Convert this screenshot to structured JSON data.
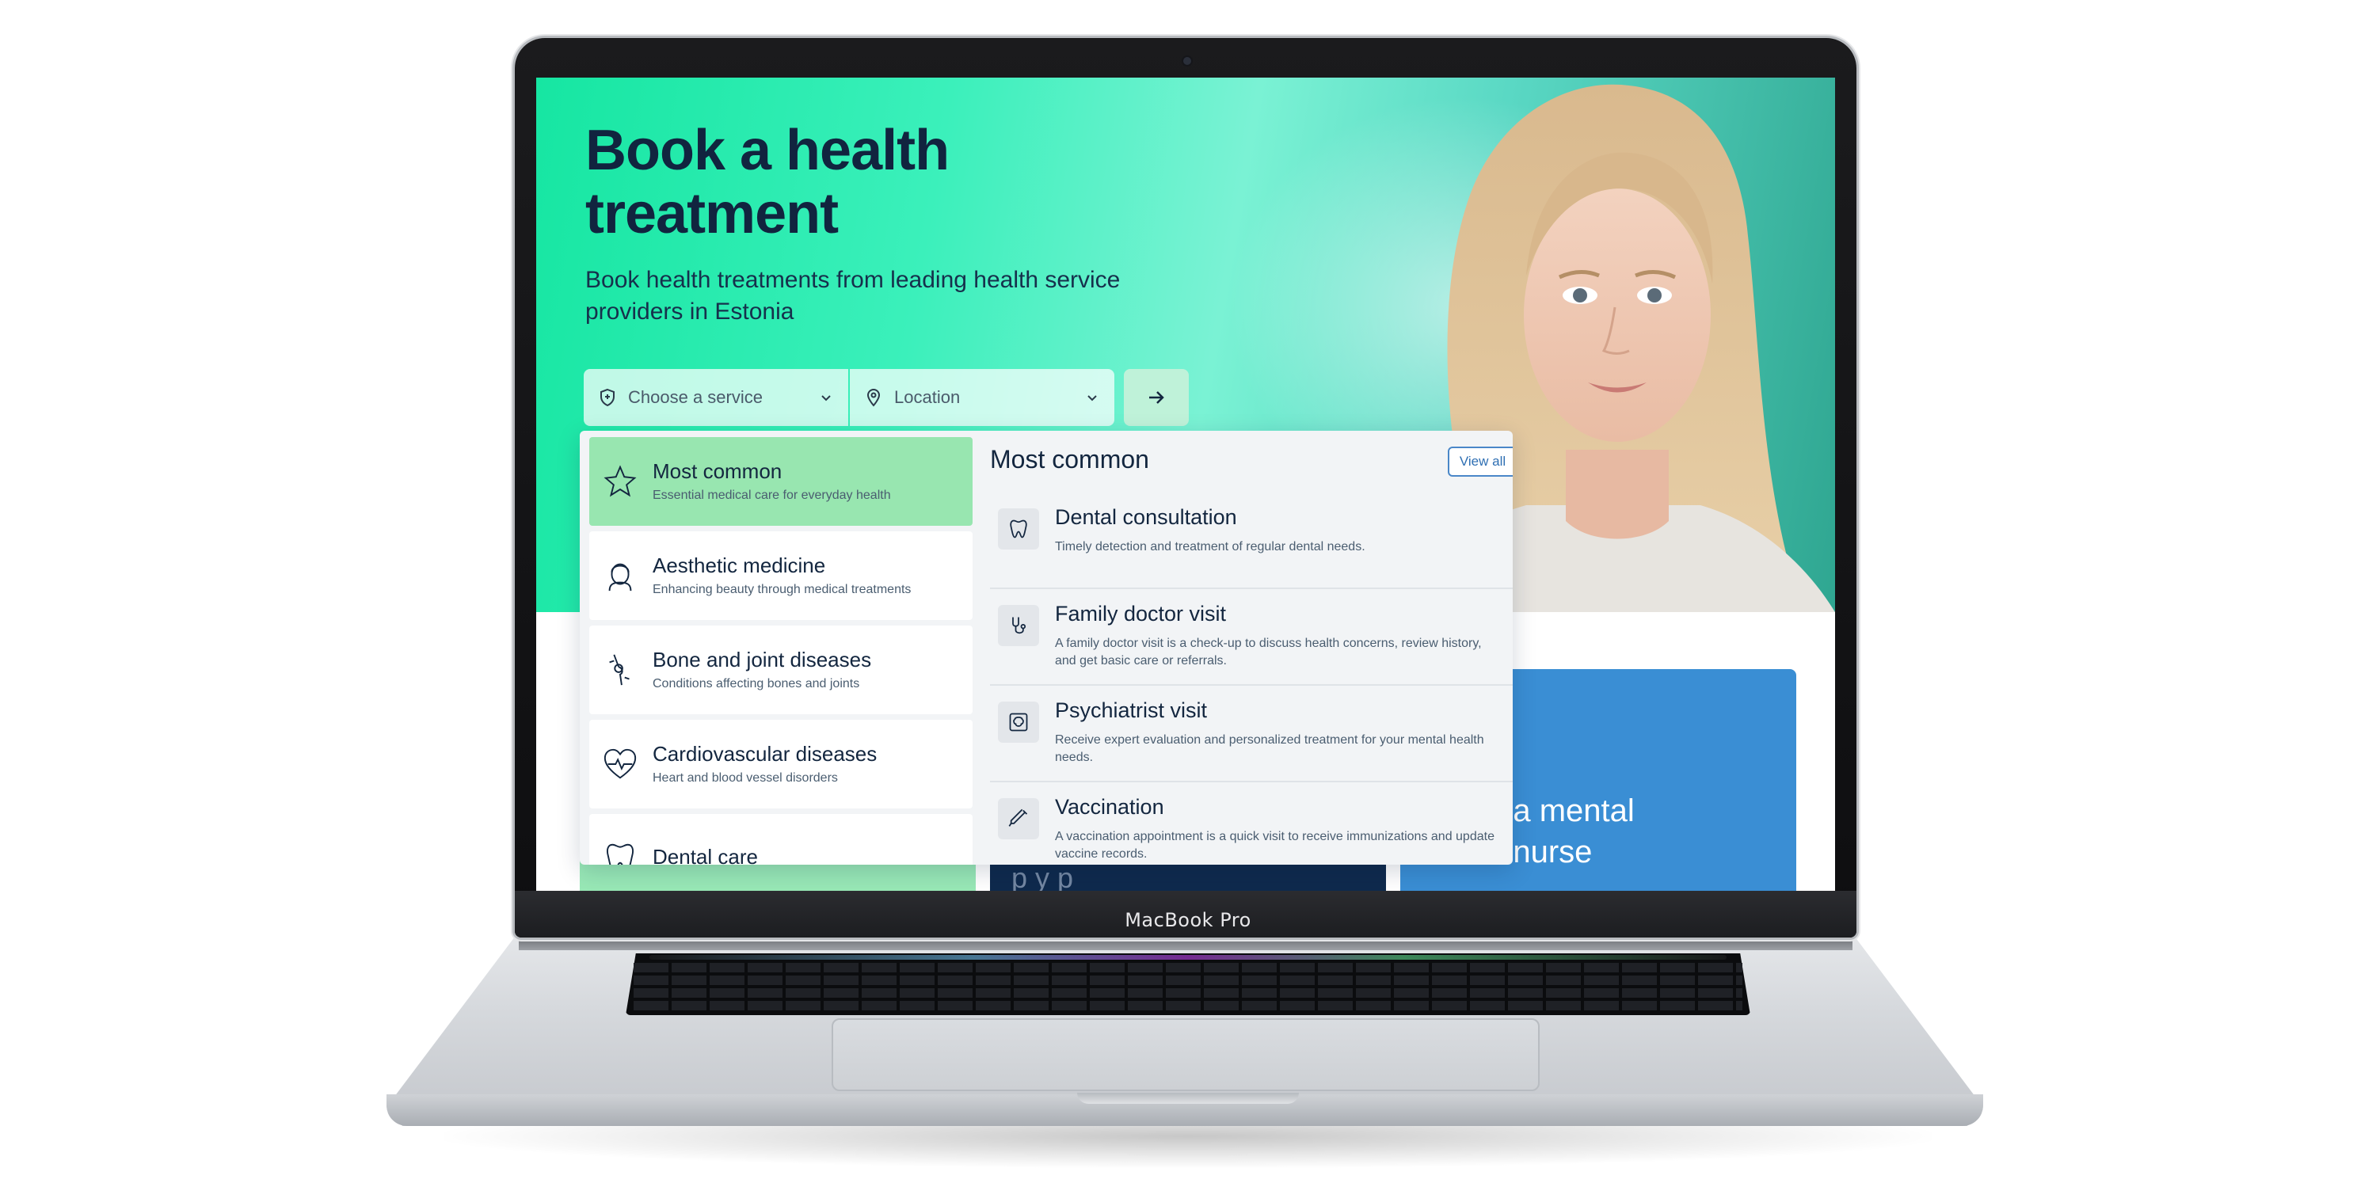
{
  "device": {
    "label": "MacBook Pro"
  },
  "hero": {
    "title": "Book a health treatment",
    "subtitle": "Book health treatments from leading health service providers in Estonia"
  },
  "search": {
    "service_placeholder": "Choose a service",
    "location_placeholder": "Location"
  },
  "dropdown": {
    "categories": [
      {
        "title": "Most common",
        "description": "Essential medical care for everyday health",
        "icon": "star-icon",
        "active": true
      },
      {
        "title": "Aesthetic medicine",
        "description": "Enhancing beauty through medical treatments",
        "icon": "face-icon"
      },
      {
        "title": "Bone and joint diseases",
        "description": "Conditions affecting bones and joints",
        "icon": "joint-icon"
      },
      {
        "title": "Cardiovascular diseases",
        "description": "Heart and blood vessel disorders",
        "icon": "heart-pulse-icon"
      },
      {
        "title": "Dental care",
        "description": "",
        "icon": "tooth-icon"
      }
    ],
    "services_heading": "Most common",
    "view_all": "View all",
    "services": [
      {
        "title": "Dental consultation",
        "description": "Timely detection and treatment of regular dental needs.",
        "icon": "tooth-icon"
      },
      {
        "title": "Family doctor visit",
        "description": "A family doctor visit is a check-up to discuss health concerns, review history, and get basic care or referrals.",
        "icon": "stethoscope-icon"
      },
      {
        "title": "Psychiatrist visit",
        "description": "Receive expert evaluation and personalized treatment for your mental health needs.",
        "icon": "brain-icon"
      },
      {
        "title": "Vaccination",
        "description": "A vaccination appointment is a quick visit to receive immunizations and update vaccine records.",
        "icon": "syringe-icon"
      }
    ]
  },
  "cards": {
    "blue_text_line1": "o a mental",
    "blue_text_line2": "h nurse",
    "navy_text": "p   y         p"
  },
  "colors": {
    "hero_green": "#16e6a2",
    "active_category": "#98e6b0",
    "heading_navy": "#11243f",
    "card_blue": "#3a8ed4",
    "view_all_blue": "#2f6fb3"
  }
}
